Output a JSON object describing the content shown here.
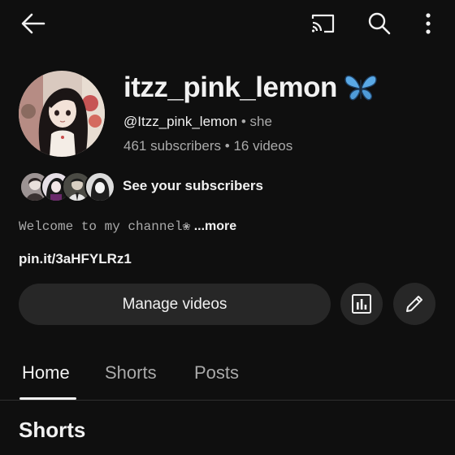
{
  "top_bar": {
    "back_icon": "arrow-left-icon",
    "cast_icon": "cast-icon",
    "search_icon": "search-icon",
    "more_icon": "more-vertical-icon"
  },
  "channel": {
    "name": "itzz_pink_lemon",
    "name_emoji": "butterfly-icon",
    "handle": "@Itzz_pink_lemon",
    "pronoun_separator": "•",
    "pronouns": "she",
    "subscribers": "461 subscribers",
    "stats_separator": "•",
    "videos": "16 videos",
    "see_subscribers": "See your subscribers",
    "description": "Welcome to my channel❀",
    "more_label": "...more",
    "link": "pin.it/3aHFYLRz1"
  },
  "actions": {
    "manage_label": "Manage videos",
    "analytics_icon": "analytics-icon",
    "edit_icon": "pencil-icon"
  },
  "tabs": [
    {
      "label": "Home",
      "active": true
    },
    {
      "label": "Shorts",
      "active": false
    },
    {
      "label": "Posts",
      "active": false
    }
  ],
  "section": {
    "title": "Shorts"
  },
  "colors": {
    "background": "#0f0f0f",
    "text_primary": "#f1f1f1",
    "text_secondary": "#aaaaaa",
    "button_bg": "#272727",
    "butterfly": "#5aa9e6"
  }
}
